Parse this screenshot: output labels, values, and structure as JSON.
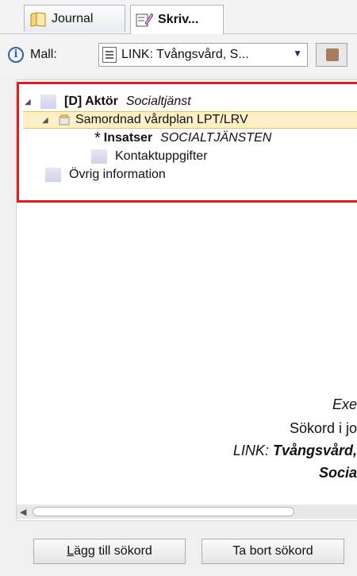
{
  "tabs": [
    {
      "label": "Journal",
      "icon": "journal-icon"
    },
    {
      "label": "Skriv...",
      "icon": "write-icon"
    }
  ],
  "toolbar": {
    "info_icon_text": "i",
    "mall_label": "Mall:",
    "mall_value": "LINK: Tvångsvård, S...",
    "dropdown_arrow": "▼"
  },
  "tree": [
    {
      "prefix": "[D] Aktör",
      "detail": "Socialtjänst"
    },
    {
      "label": "Samordnad vårdplan LPT/LRV"
    },
    {
      "marker": "*",
      "prefix": "Insatser",
      "detail": "SOCIALTJÄNSTEN"
    },
    {
      "label": "Kontaktuppgifter"
    },
    {
      "label": "Övrig information"
    }
  ],
  "background_text": {
    "line1": "Exe",
    "line2": "Sökord i jo",
    "line3_prefix": "LINK: ",
    "line3_bold": "Tvångsvård,",
    "line4": "Socia"
  },
  "buttons": {
    "add_accesskey": "L",
    "add_rest": "ägg till sökord",
    "remove": "Ta bort sökord"
  },
  "colors": {
    "highlight_border": "#e31b1b",
    "selected_row": "#fcefc9",
    "accent_blue": "#2f62b0"
  }
}
